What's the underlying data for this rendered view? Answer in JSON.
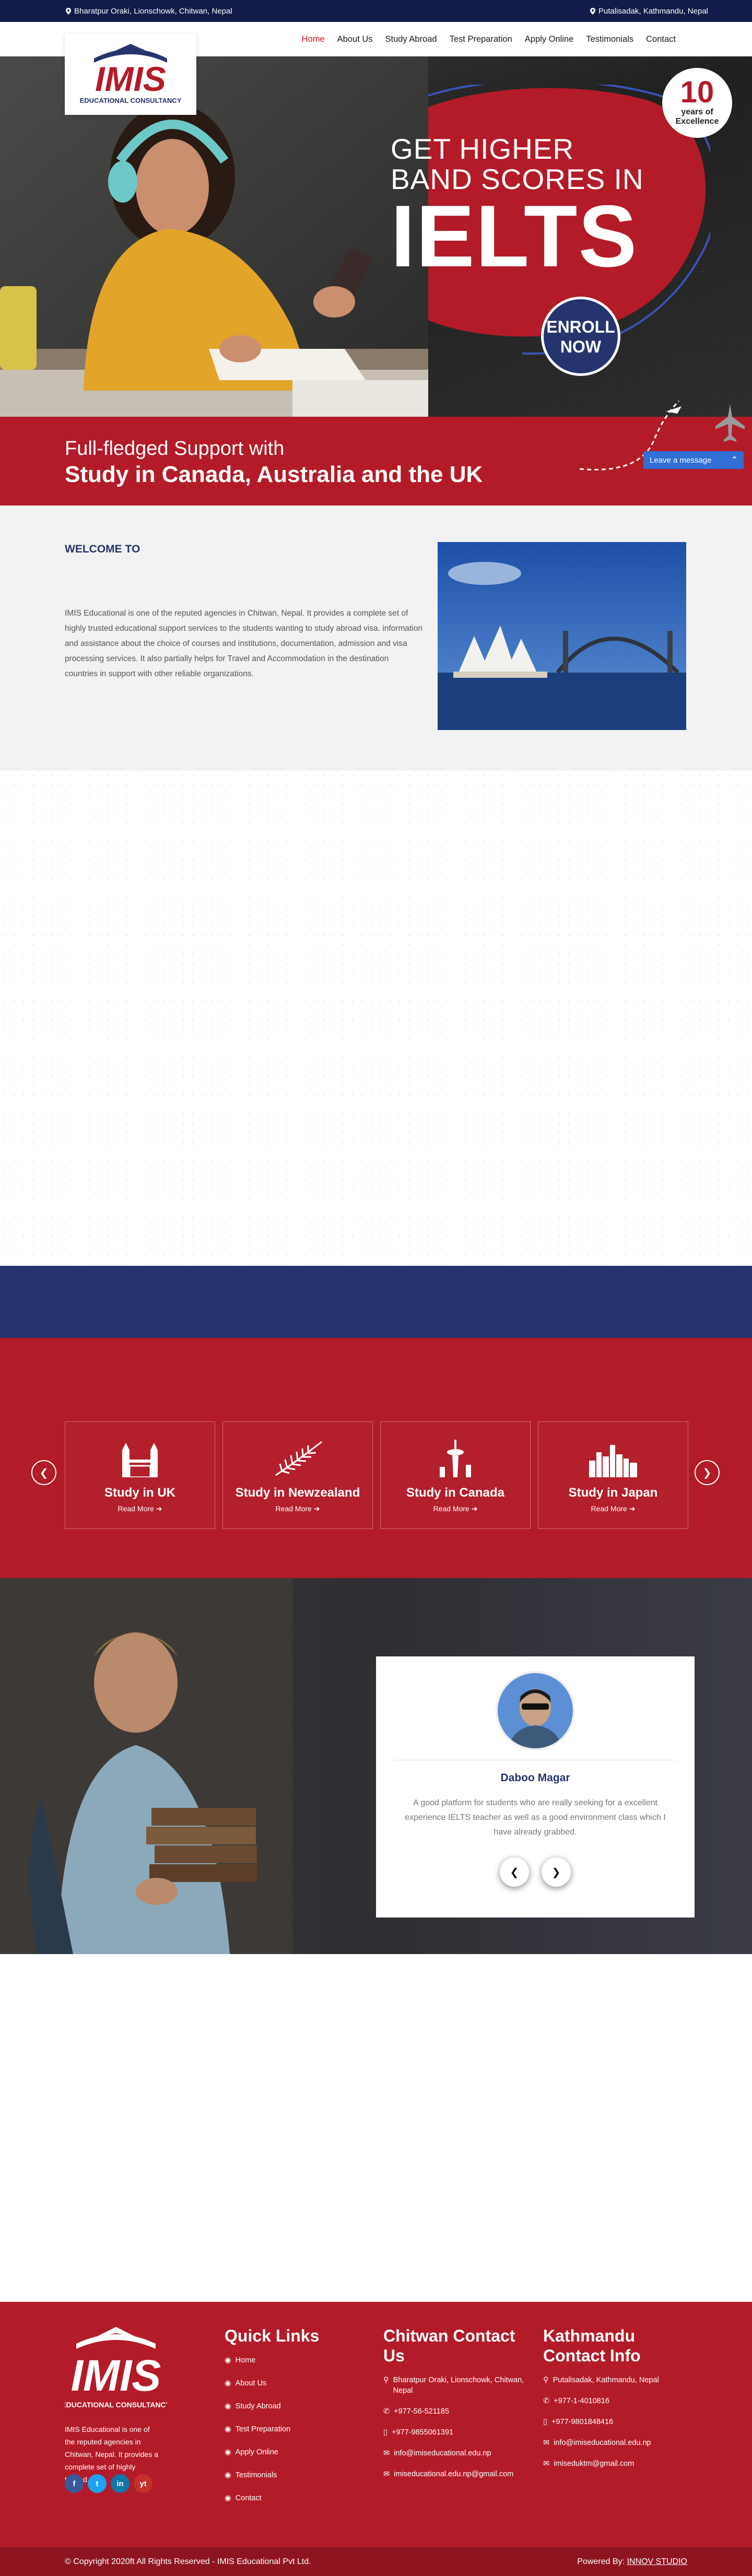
{
  "topbar": {
    "left_address": "Bharatpur Oraki, Lionschowk, Chitwan, Nepal",
    "right_address": "Putalisadak, Kathmandu, Nepal"
  },
  "nav": {
    "items": [
      "Home",
      "About Us",
      "Study Abroad",
      "Test Preparation",
      "Apply Online",
      "Testimonials",
      "Contact"
    ],
    "active": "Home"
  },
  "logo": {
    "brand": "IMIS",
    "sub": "EDUCATIONAL CONSULTANCY"
  },
  "hero": {
    "line1": "GET HIGHER",
    "line2": "BAND SCORES IN",
    "big": "IELTS",
    "badge_number": "10",
    "badge_text1": "years of",
    "badge_text2": "Excellence",
    "enroll1": "ENROLL",
    "enroll2": "NOW",
    "band_line1": "Full-fledged Support with",
    "band_line2": "Study in Canada, Australia and the UK"
  },
  "chat": {
    "label": "Leave a message"
  },
  "welcome": {
    "title": "WELCOME TO",
    "text": "IMIS Educational is one of the reputed agencies in Chitwan, Nepal. It provides a complete set of highly trusted educational support services to the students wanting to study abroad visa. information and assistance about the choice of courses and institutions, documentation, admission and visa processing services. It also partially helps for Travel and Accommodation in the destination countries in support with other reliable organizations."
  },
  "study": {
    "cards": [
      {
        "name": "Study in UK",
        "more": "Read More"
      },
      {
        "name": "Study in Newzealand",
        "more": "Read More"
      },
      {
        "name": "Study in Canada",
        "more": "Read More"
      },
      {
        "name": "Study in Japan",
        "more": "Read More"
      }
    ]
  },
  "testimonial": {
    "name": "Daboo Magar",
    "text": "A good platform for students who are really seeking for a excellent experience IELTS teacher as well as a good environment class which I have already grabbed."
  },
  "footer": {
    "about": "IMIS Educational is one of the reputed agencies in Chitwan, Nepal. It provides a complete set of highly trusted.",
    "social": [
      "f",
      "t",
      "in",
      "yt"
    ],
    "quick_links_title": "Quick Links",
    "quick_links": [
      "Home",
      "About Us",
      "Study Abroad",
      "Test Preparation",
      "Apply Online",
      "Testimonials",
      "Contact"
    ],
    "chitwan_title": "Chitwan Contact Us",
    "chitwan": [
      "Bharatpur Oraki, Lionschowk, Chitwan, Nepal",
      "+977-56-521185",
      "+977-9855061391",
      "info@imiseducational.edu.np",
      "imiseducational.edu.np@gmail.com"
    ],
    "kathmandu_title": "Kathmandu Contact Info",
    "kathmandu": [
      "Putalisadak, Kathmandu, Nepal",
      "+977-1-4010816",
      "+977-9801848416",
      "info@imiseducational.edu.np",
      "imiseduktm@gmail.com"
    ],
    "copyright": "© Copyright 2020ft All Rights Reserved - IMIS Educational Pvt Ltd.",
    "powered_prefix": "Powered By:",
    "powered_name": "INNOV STUDIO"
  },
  "colors": {
    "brand_red": "#b31b28",
    "navy": "#26346e",
    "topbar": "#131b4a",
    "chat_blue": "#2f6fd6"
  }
}
